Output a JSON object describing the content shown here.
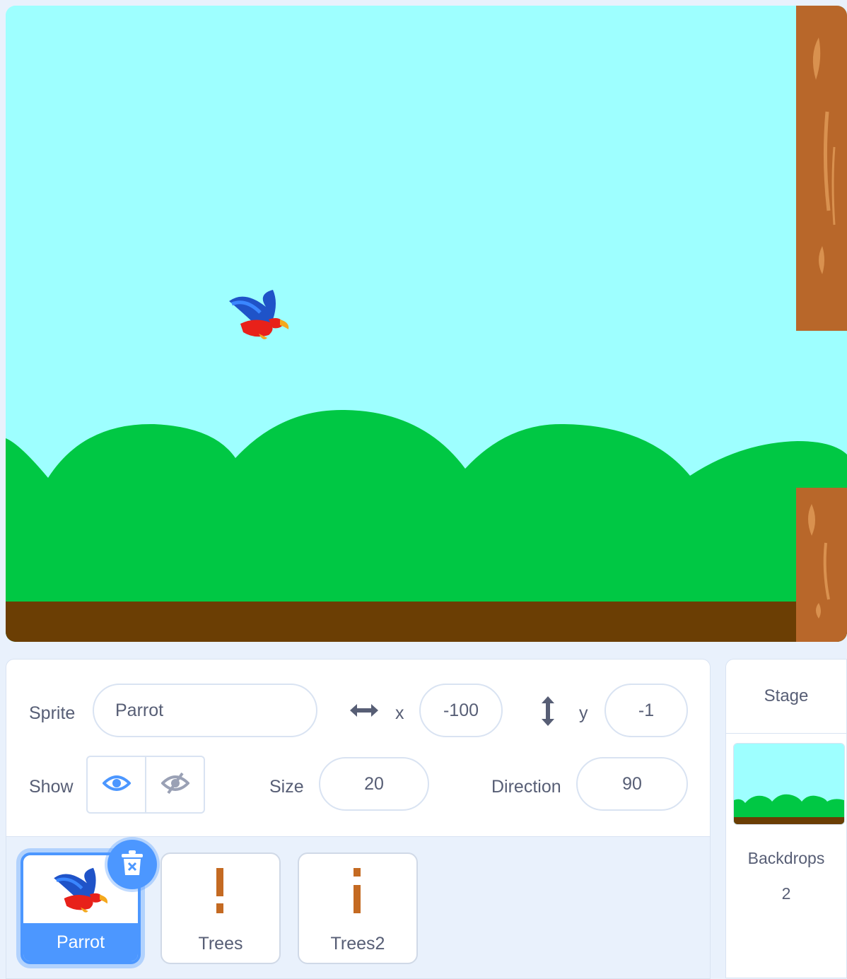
{
  "sprite_info": {
    "sprite_label": "Sprite",
    "sprite_name": "Parrot",
    "x_label": "x",
    "x_value": "-100",
    "y_label": "y",
    "y_value": "-1",
    "show_label": "Show",
    "size_label": "Size",
    "size_value": "20",
    "direction_label": "Direction",
    "direction_value": "90"
  },
  "sprites": [
    {
      "name": "Parrot",
      "selected": true
    },
    {
      "name": "Trees",
      "selected": false
    },
    {
      "name": "Trees2",
      "selected": false
    }
  ],
  "stage_pane": {
    "title": "Stage",
    "backdrops_label": "Backdrops",
    "backdrops_count": "2"
  },
  "icons": [
    "arrows-horizontal-icon",
    "arrows-vertical-icon",
    "eye-icon",
    "eye-slash-icon",
    "trash-icon"
  ],
  "colors": {
    "accent": "#4c97ff",
    "sky": "#9effff",
    "hills": "#00c844",
    "ground": "#6b3e04",
    "trunk": "#b8672a"
  }
}
